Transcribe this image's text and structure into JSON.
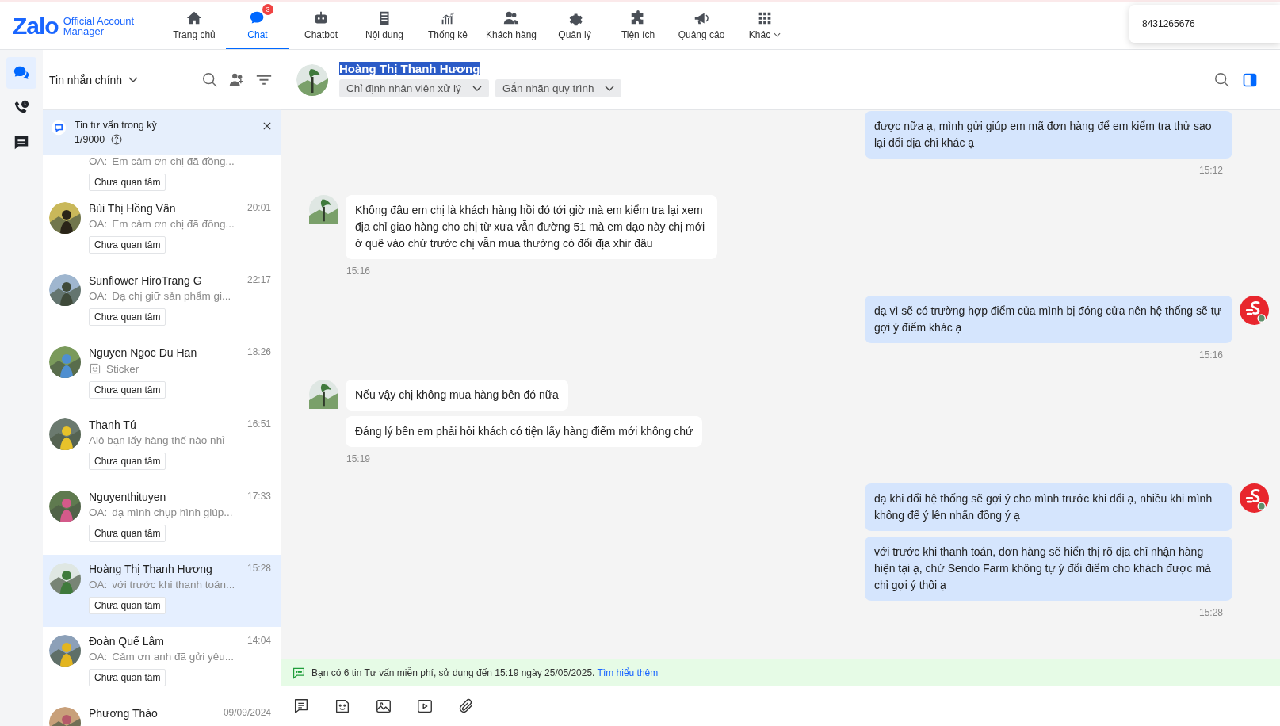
{
  "logo": {
    "brand": "Zalo",
    "line1": "Official Account",
    "line2": "Manager"
  },
  "nav": [
    {
      "label": "Trang chủ",
      "selected": false
    },
    {
      "label": "Chat",
      "selected": true,
      "badge": "3"
    },
    {
      "label": "Chatbot",
      "selected": false
    },
    {
      "label": "Nội dung",
      "selected": false
    },
    {
      "label": "Thống kê",
      "selected": false
    },
    {
      "label": "Khách hàng",
      "selected": false
    },
    {
      "label": "Quản lý",
      "selected": false
    },
    {
      "label": "Tiện ích",
      "selected": false
    },
    {
      "label": "Quảng cáo",
      "selected": false
    },
    {
      "label": "Khác",
      "selected": false,
      "dropdown": true
    }
  ],
  "account": {
    "phone": "8431265676"
  },
  "rail": [
    {
      "selected": true
    },
    {
      "selected": false
    },
    {
      "selected": false
    }
  ],
  "list_header": {
    "title": "Tin nhắn chính"
  },
  "banner": {
    "title": "Tin tư vấn trong kỳ",
    "count": "1/9000"
  },
  "conversations": [
    {
      "partial": true,
      "prefix": "OA:",
      "preview": "Em cảm ơn chị đã đồng...",
      "tag": "Chưa quan tâm",
      "selected": false
    },
    {
      "name": "Bùi Thị Hồng Vân",
      "time": "20:01",
      "prefix": "OA:",
      "preview": "Em cảm ơn chị đã đồng...",
      "tag": "Chưa quan tâm",
      "selected": false
    },
    {
      "name": "Sunflower HiroTrang G",
      "time": "22:17",
      "prefix": "OA:",
      "preview": "Dạ chị giữ sản phẩm gi...",
      "tag": "Chưa quan tâm",
      "selected": false
    },
    {
      "name": "Nguyen Ngoc Du Han",
      "time": "18:26",
      "kind": "sticker",
      "preview": "Sticker",
      "tag": "Chưa quan tâm",
      "selected": false
    },
    {
      "name": "Thanh Tú",
      "time": "16:51",
      "preview": "Alô bạn lấy hàng thế nào nhỉ",
      "tag": "Chưa quan tâm",
      "selected": false
    },
    {
      "name": "Nguyenthituyen",
      "time": "17:33",
      "prefix": "OA:",
      "preview": "dạ mình chụp hình giúp...",
      "tag": "Chưa quan tâm",
      "selected": false
    },
    {
      "name": "Hoàng Thị Thanh Hương",
      "time": "15:28",
      "prefix": "OA:",
      "preview": "với trước khi thanh toán...",
      "tag": "Chưa quan tâm",
      "selected": true
    },
    {
      "name": "Đoàn Quế Lâm",
      "time": "14:04",
      "prefix": "OA:",
      "preview": "Cảm ơn anh đã gửi yêu...",
      "tag": "Chưa quan tâm",
      "selected": false
    },
    {
      "name": "Phương Thảo",
      "time": "09/09/2024",
      "selected": false
    }
  ],
  "chat_header": {
    "name": "Hoàng Thị Thanh Hương",
    "highlighted": true,
    "assign": "Chỉ định nhân viên xử lý",
    "label": "Gắn nhãn quy trình"
  },
  "messages": [
    {
      "kind": "oa",
      "avatar": false,
      "bubbles": [
        "được nữa ạ, mình gửi giúp em mã đơn hàng để em kiểm tra thử sao lại đổi địa chỉ khác ạ"
      ],
      "time": "15:12"
    },
    {
      "kind": "customer",
      "avatar": true,
      "bubbles": [
        "Không đâu em chị là khách hàng hồi đó tới giờ mà em kiểm tra lại xem địa chỉ giao hàng cho chị từ xưa vẫn đường 51 mà em dạo này chị mới ở quê vào chứ trước chị vẫn mua thường có đổi địa xhir đâu"
      ],
      "time": "15:16"
    },
    {
      "kind": "oa",
      "avatar": true,
      "bubbles": [
        "dạ vì sẽ có trường hợp điểm của mình bị đóng cửa nên hệ thống sẽ tự gợi ý điểm khác ạ"
      ],
      "time": "15:16"
    },
    {
      "kind": "customer",
      "avatar": true,
      "bubbles": [
        "Nếu vậy chị không mua hàng bên đó nữa",
        "Đáng lý bên em phải hỏi khách có tiện lấy hàng điểm mới không chứ"
      ],
      "time": "15:19"
    },
    {
      "kind": "oa",
      "avatar": true,
      "bubbles": [
        "dạ khi đổi hệ thống sẽ gợi ý cho mình trước khi đổi ạ, nhiều khi mình không để ý lên nhấn đồng ý ạ",
        "với trước khi thanh toán, đơn hàng sẽ hiển thị rõ địa chỉ nhận hàng hiện tại ạ, chứ Sendo Farm không tự ý đổi điểm cho khách được mà chỉ gợi ý thôi ạ"
      ],
      "time": "15:28"
    }
  ],
  "notice": {
    "text": "Bạn có 6 tin Tư vấn miễn phí, sử dụng đến 15:19 ngày 25/05/2025.",
    "link": "Tìm hiểu thêm"
  }
}
